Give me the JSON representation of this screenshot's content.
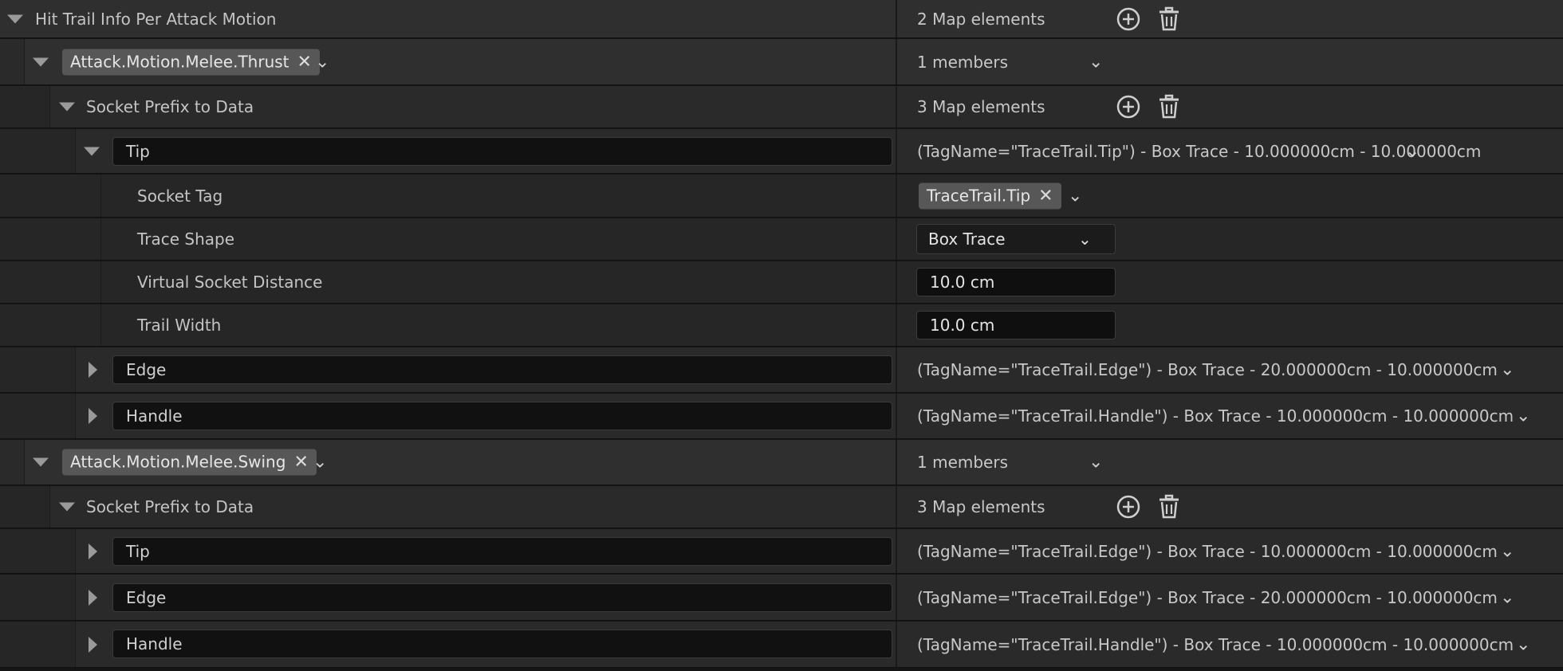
{
  "root": {
    "label": "Hit Trail Info Per Attack Motion",
    "value": "2 Map elements"
  },
  "entries": [
    {
      "tag": "Attack.Motion.Melee.Thrust",
      "members": "1 members",
      "socket_label": "Socket Prefix to Data",
      "socket_value": "3 Map elements",
      "items": [
        {
          "key": "Tip",
          "summary": "(TagName=\"TraceTrail.Tip\") - Box Trace - 10.000000cm - 10.000000cm"
        },
        {
          "key": "Edge",
          "summary": "(TagName=\"TraceTrail.Edge\") - Box Trace - 20.000000cm - 10.000000cm"
        },
        {
          "key": "Handle",
          "summary": "(TagName=\"TraceTrail.Handle\") - Box Trace - 10.000000cm - 10.000000cm"
        }
      ],
      "tip_details": {
        "socket_tag_label": "Socket Tag",
        "socket_tag_value": "TraceTrail.Tip",
        "trace_shape_label": "Trace Shape",
        "trace_shape_value": "Box Trace",
        "virtual_distance_label": "Virtual Socket Distance",
        "virtual_distance_value": "10.0 cm",
        "trail_width_label": "Trail Width",
        "trail_width_value": "10.0 cm"
      }
    },
    {
      "tag": "Attack.Motion.Melee.Swing",
      "members": "1 members",
      "socket_label": "Socket Prefix to Data",
      "socket_value": "3 Map elements",
      "items": [
        {
          "key": "Tip",
          "summary": "(TagName=\"TraceTrail.Edge\") - Box Trace - 10.000000cm - 10.000000cm"
        },
        {
          "key": "Edge",
          "summary": "(TagName=\"TraceTrail.Edge\") - Box Trace - 20.000000cm - 10.000000cm"
        },
        {
          "key": "Handle",
          "summary": "(TagName=\"TraceTrail.Handle\") - Box Trace - 10.000000cm - 10.000000cm"
        }
      ]
    }
  ],
  "glyphs": {
    "remove": "✕",
    "chevron": "⌄"
  },
  "icons": {
    "add": "plus-circle-icon",
    "delete": "trash-icon"
  }
}
